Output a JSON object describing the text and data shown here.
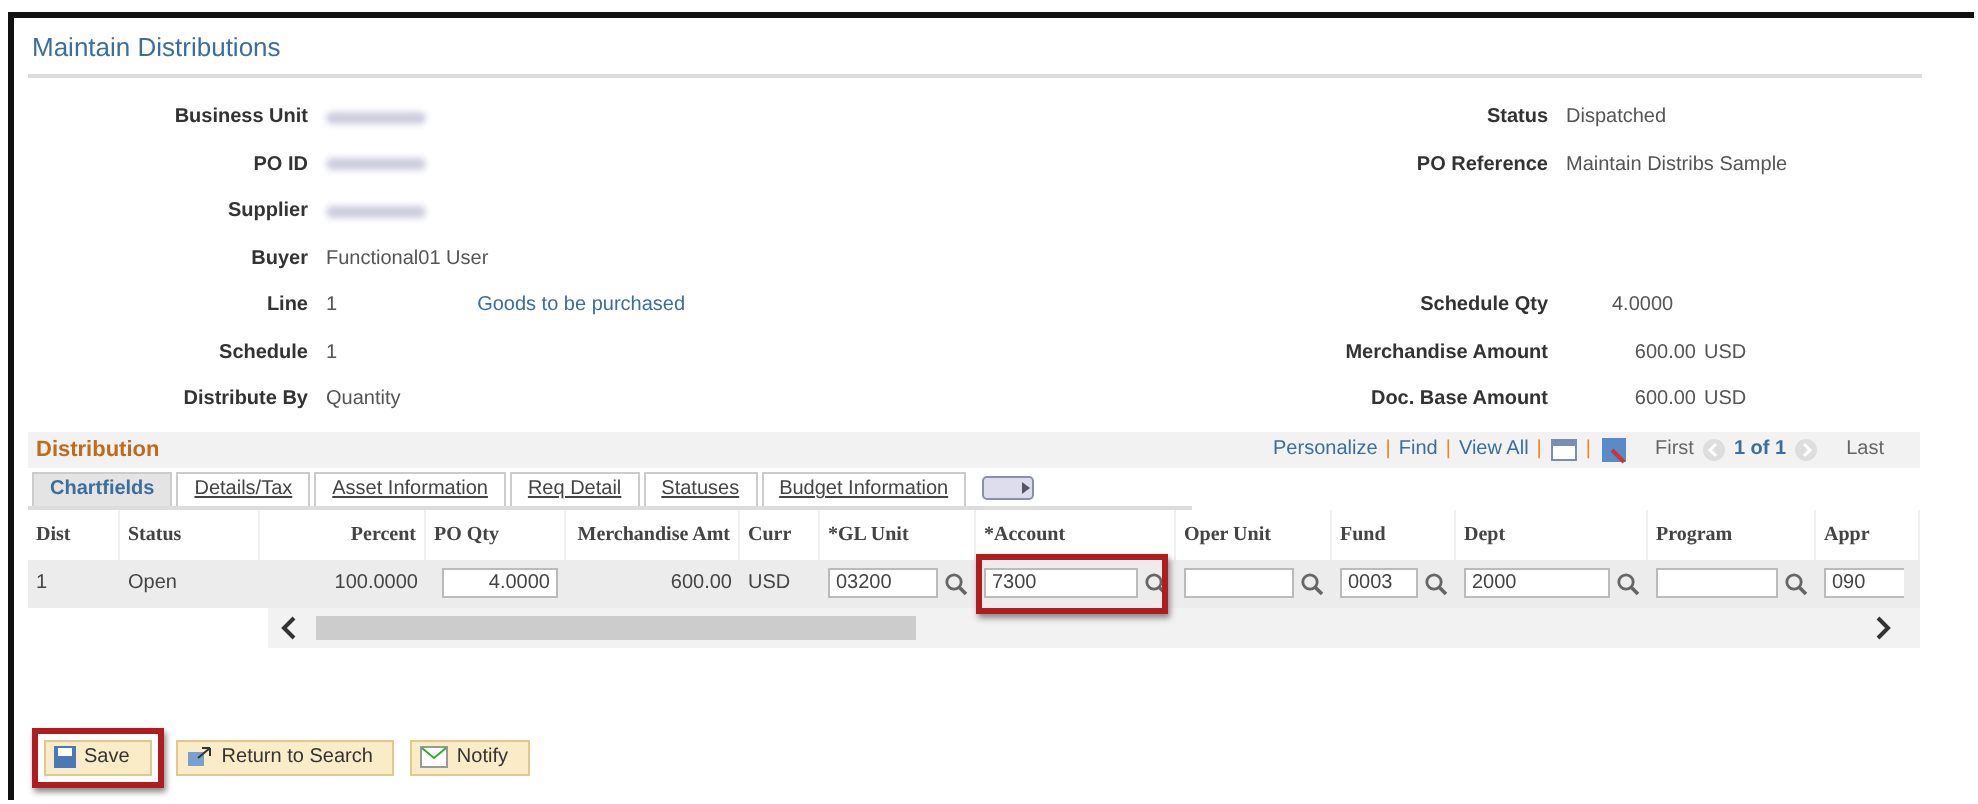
{
  "page_title": "Maintain Distributions",
  "header_left": [
    {
      "label": "Business Unit",
      "kind": "blurred"
    },
    {
      "label": "PO ID",
      "kind": "blurred"
    },
    {
      "label": "Supplier",
      "kind": "blurred"
    },
    {
      "label": "Buyer",
      "kind": "text",
      "value": "Functional01 User"
    },
    {
      "label": "Line",
      "kind": "text",
      "value": "1",
      "link": "Goods to be purchased"
    },
    {
      "label": "Schedule",
      "kind": "text",
      "value": "1"
    },
    {
      "label": "Distribute By",
      "kind": "text",
      "value": "Quantity"
    }
  ],
  "header_right_top": [
    {
      "label": "Status",
      "value": "Dispatched"
    },
    {
      "label": "PO Reference",
      "value": "Maintain Distribs Sample"
    }
  ],
  "header_right_bottom": [
    {
      "label": "Schedule Qty",
      "value": "4.0000"
    },
    {
      "label": "Merchandise Amount",
      "value": "600.00",
      "unit": "USD"
    },
    {
      "label": "Doc. Base Amount",
      "value": "600.00",
      "unit": "USD"
    }
  ],
  "distribution": {
    "title": "Distribution",
    "nav": [
      {
        "kind": "link",
        "text": "Personalize"
      },
      {
        "kind": "sep",
        "text": "|"
      },
      {
        "kind": "link",
        "text": "Find"
      },
      {
        "kind": "sep",
        "text": "|"
      },
      {
        "kind": "link",
        "text": "View All"
      },
      {
        "kind": "sep",
        "text": "|"
      },
      {
        "kind": "zoom-icon"
      },
      {
        "kind": "sep",
        "text": "|"
      },
      {
        "kind": "download-icon"
      },
      {
        "kind": "label",
        "text": "First"
      },
      {
        "kind": "prev-icon"
      },
      {
        "kind": "count",
        "text": "1 of 1"
      },
      {
        "kind": "next-icon"
      },
      {
        "kind": "label",
        "text": "Last"
      }
    ],
    "tabs": [
      {
        "label": "Chartfields",
        "selected": true
      },
      {
        "label": "Details/Tax",
        "selected": false
      },
      {
        "label": "Asset Information",
        "selected": false
      },
      {
        "label": "Req Detail",
        "selected": false
      },
      {
        "label": "Statuses",
        "selected": false
      },
      {
        "label": "Budget Information",
        "selected": false
      }
    ],
    "columns": [
      "Dist",
      "Status",
      "Percent",
      "PO Qty",
      "Merchandise Amt",
      "Curr",
      "*GL Unit",
      "*Account",
      "Oper Unit",
      "Fund",
      "Dept",
      "Program",
      "Appr"
    ],
    "rows": [
      [
        {
          "kind": "text",
          "text": "1"
        },
        {
          "kind": "text",
          "text": "Open"
        },
        {
          "kind": "num",
          "text": "100.0000"
        },
        {
          "kind": "input",
          "text": "4.0000"
        },
        {
          "kind": "num",
          "text": "600.00"
        },
        {
          "kind": "text",
          "text": "USD"
        },
        {
          "kind": "lookup",
          "text": "03200",
          "highlighted": false
        },
        {
          "kind": "lookup",
          "text": "7300",
          "highlighted": true
        },
        {
          "kind": "lookup",
          "highlighted": false
        },
        {
          "kind": "lookup",
          "text": "0003",
          "highlighted": false
        },
        {
          "kind": "lookup",
          "text": "2000",
          "highlighted": false
        },
        {
          "kind": "lookup",
          "highlighted": false
        },
        {
          "kind": "cut",
          "text": "090"
        }
      ]
    ]
  },
  "buttons": [
    {
      "label": "Save",
      "kind": "save",
      "highlighted": true
    },
    {
      "label": "Return to Search",
      "kind": "return",
      "highlighted": false
    },
    {
      "label": "Notify",
      "kind": "notify",
      "highlighted": false
    }
  ]
}
